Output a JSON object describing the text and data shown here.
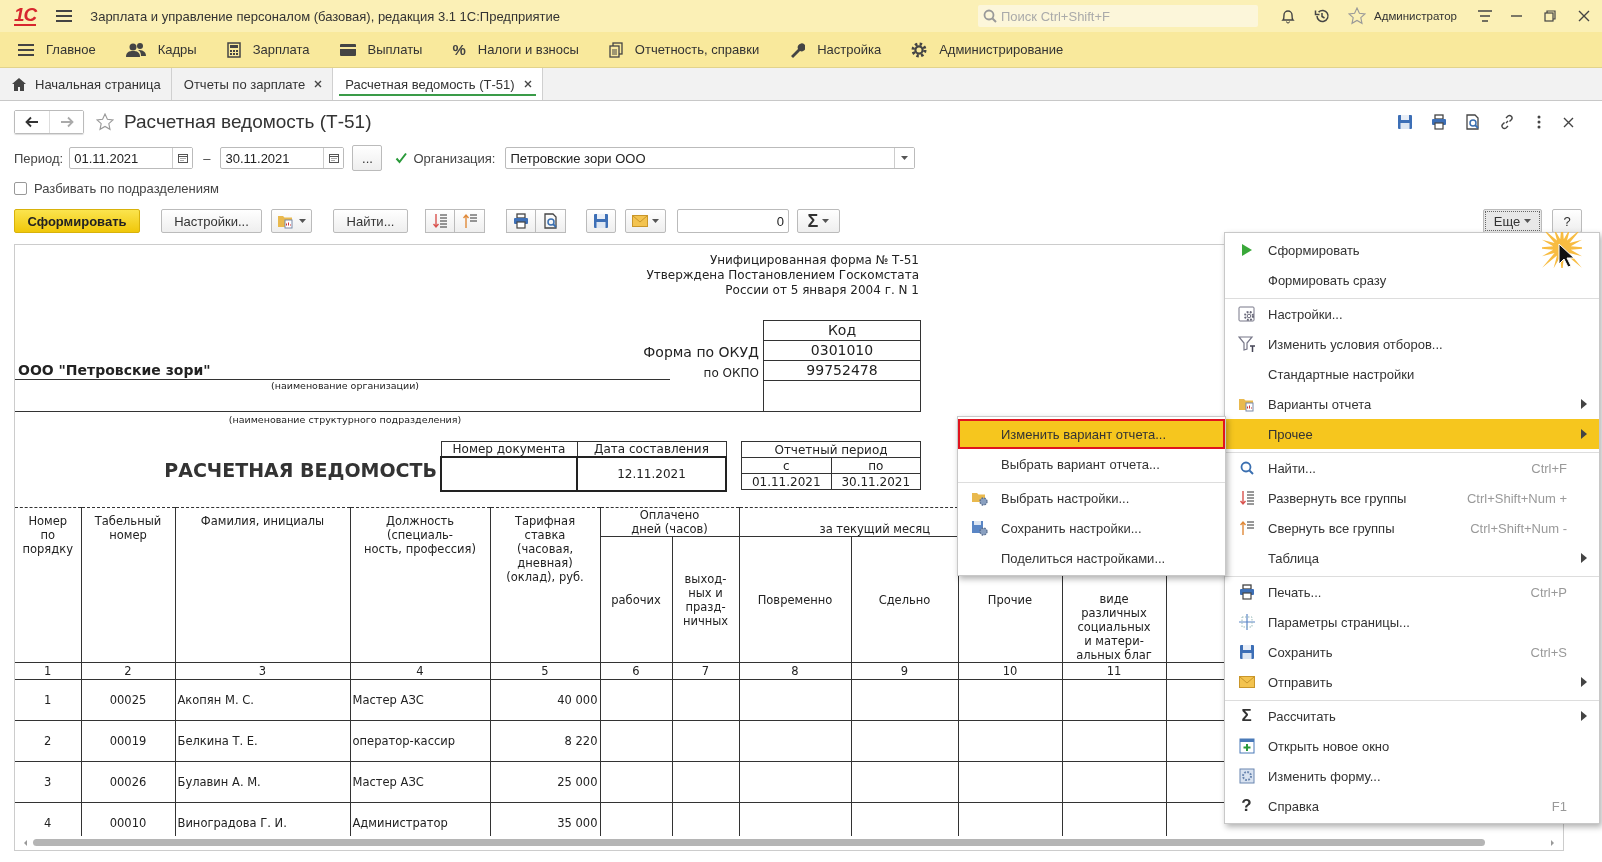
{
  "window": {
    "logo": "1С",
    "title": "Зарплата и управление персоналом (базовая), редакция 3.1 1С:Предприятие",
    "search_placeholder": "Поиск Ctrl+Shift+F",
    "user": "Администратор"
  },
  "sections": [
    {
      "label": "Главное"
    },
    {
      "label": "Кадры"
    },
    {
      "label": "Зарплата"
    },
    {
      "label": "Выплаты"
    },
    {
      "label": "Налоги и взносы",
      "glyph": "%"
    },
    {
      "label": "Отчетность, справки"
    },
    {
      "label": "Настройка"
    },
    {
      "label": "Администрирование"
    }
  ],
  "tabs": [
    {
      "label": "Начальная страница",
      "selected": false,
      "closable": false
    },
    {
      "label": "Отчеты по зарплате",
      "selected": false,
      "closable": true
    },
    {
      "label": "Расчетная ведомость (Т-51)",
      "selected": true,
      "closable": true
    }
  ],
  "form": {
    "title": "Расчетная ведомость (Т-51)",
    "favorite": false,
    "period_label": "Период:",
    "date_from": "01.11.2021",
    "dash": "–",
    "date_to": "30.11.2021",
    "choose_period": "...",
    "organization_checked": true,
    "organization_label": "Организация:",
    "organization": "Петровские зори ООО",
    "split_checked": false,
    "split_label": "Разбивать по подразделениям"
  },
  "toolbar": {
    "generate": "Сформировать",
    "settings": "Настройки...",
    "find": "Найти...",
    "amount": "0",
    "sum_glyph": "Σ",
    "more": "Еще",
    "help": "?"
  },
  "report": {
    "form_note": [
      "Унифицированная форма № Т-51",
      "Утверждена Постановлением Госкомстата",
      "России от 5 января 2004 г. N 1"
    ],
    "code_header": "Код",
    "okud_label": "Форма по ОКУД",
    "okud": "0301010",
    "okpo_label": "по ОКПО",
    "okpo": "99752478",
    "organization": "ООО \"Петровские зори\"",
    "organization_caption": "(наименование организации)",
    "department_caption": "(наименование структурного подразделения)",
    "title": "РАСЧЕТНАЯ ВЕДОМОСТЬ",
    "number_header": "Номер документа",
    "date_header": "Дата составления",
    "date": "12.11.2021",
    "period_header": "Отчетный период",
    "from_label": "с",
    "to_label": "по",
    "from": "01.11.2021",
    "to": "30.11.2021",
    "table": {
      "groups": [
        {
          "label": "Оплачено\nдней (часов)"
        },
        {
          "label": "за текущий месяц"
        }
      ],
      "columns": [
        {
          "header": "Номер\nпо\nпорядку",
          "number": "1"
        },
        {
          "header": "Табельный\nномер",
          "number": "2"
        },
        {
          "header": "Фамилия, инициалы",
          "number": "3"
        },
        {
          "header": "Должность\n(специаль-\nность, профессия)",
          "number": "4"
        },
        {
          "header": "Тарифная\nставка\n(часовая,\nдневная)\n(оклад), руб.",
          "number": "5"
        },
        {
          "header": "рабочих",
          "number": "6"
        },
        {
          "header": "выход-\nных и\nпразд-\nничных",
          "number": "7"
        },
        {
          "header": "Повременно",
          "number": "8"
        },
        {
          "header": "Сдельно",
          "number": "9"
        },
        {
          "header": "Прочие",
          "number": "10"
        },
        {
          "header": "виде\nразличных\nсоциальных\nи матери-\nальных благ",
          "number": "11"
        }
      ],
      "rows": [
        [
          "1",
          "00025",
          "Акопян М. С.",
          "Мастер АЗС",
          "40 000"
        ],
        [
          "2",
          "00019",
          "Белкина Т. Е.",
          "оператор-кассир",
          "8 220"
        ],
        [
          "3",
          "00026",
          "Булавин А. М.",
          "Мастер АЗС",
          "25 000"
        ],
        [
          "4",
          "00010",
          "Виноградова Г. И.",
          "Администратор",
          "35 000"
        ]
      ]
    }
  },
  "context_menu": {
    "items": [
      {
        "label": "Сформировать",
        "selected": false
      },
      {
        "label": "Формировать сразу",
        "selected": false
      },
      {
        "label": "Настройки...",
        "selected": false,
        "separator_before": true
      },
      {
        "label": "Изменить условия отборов...",
        "selected": false
      },
      {
        "label": "Стандартные настройки",
        "selected": false
      },
      {
        "label": "Варианты отчета",
        "selected": false,
        "submenu": true
      },
      {
        "label": "Прочее",
        "selected": true,
        "submenu": true
      },
      {
        "label": "Найти...",
        "shortcut": "Ctrl+F",
        "selected": false,
        "separator_before": true
      },
      {
        "label": "Развернуть все группы",
        "shortcut": "Ctrl+Shift+Num +",
        "selected": false
      },
      {
        "label": "Свернуть все группы",
        "shortcut": "Ctrl+Shift+Num -",
        "selected": false
      },
      {
        "label": "Таблица",
        "selected": false,
        "submenu": true
      },
      {
        "label": "Печать...",
        "shortcut": "Ctrl+P",
        "selected": false,
        "separator_before": true
      },
      {
        "label": "Параметры страницы...",
        "selected": false
      },
      {
        "label": "Сохранить",
        "shortcut": "Ctrl+S",
        "selected": false
      },
      {
        "label": "Отправить",
        "selected": false,
        "submenu": true
      },
      {
        "label": "Рассчитать",
        "glyph": "Σ",
        "selected": false,
        "submenu": true,
        "separator_before": true
      },
      {
        "label": "Открыть новое окно",
        "selected": false
      },
      {
        "label": "Изменить форму...",
        "selected": false
      },
      {
        "label": "Справка",
        "glyph": "?",
        "shortcut": "F1",
        "selected": false
      }
    ]
  },
  "submenu": {
    "items": [
      {
        "label": "Изменить вариант отчета...",
        "selected": true,
        "highlighted": true
      },
      {
        "label": "Выбрать вариант отчета...",
        "selected": false,
        "highlighted": false
      },
      {
        "label": "Выбрать настройки...",
        "selected": false,
        "highlighted": false,
        "separator_before": true
      },
      {
        "label": "Сохранить настройки...",
        "selected": false,
        "highlighted": false
      },
      {
        "label": "Поделиться настройками...",
        "selected": false,
        "highlighted": false
      }
    ]
  }
}
